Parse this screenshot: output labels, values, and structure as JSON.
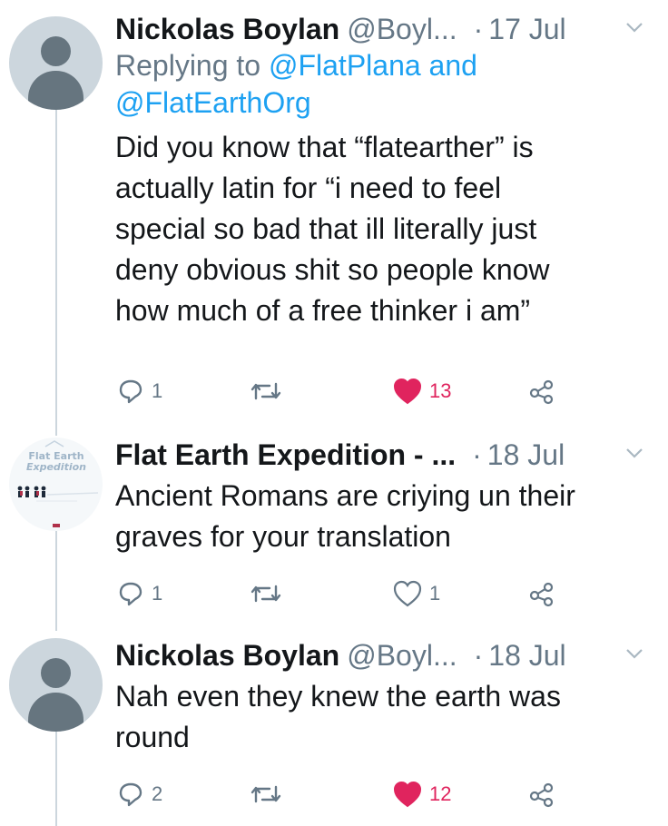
{
  "tweets": [
    {
      "name": "Nickolas Boylan",
      "handle": "@Boyl...",
      "dot": "·",
      "time": "17 Jul",
      "replying_prefix": "Replying to",
      "replying_user1": "@FlatPlana",
      "replying_and": "and",
      "replying_user2": "@FlatEarthOrg",
      "text_lines": [
        "Did you know that “flatearther” is",
        "actually latin for “i need to feel",
        "special so bad that ill literally just",
        "deny obvious shit so people know",
        "how much of a free thinker i am”"
      ],
      "reply_count": "1",
      "like_count": "13",
      "liked": true
    },
    {
      "name": "Flat Earth Expedition - ...",
      "dot": "·",
      "time": "18 Jul",
      "avatar_text_1": "Flat Earth",
      "avatar_text_2": "Expedition",
      "text_lines": [
        "Ancient Romans are criying un their",
        "graves for your translation"
      ],
      "reply_count": "1",
      "like_count": "1",
      "liked": false
    },
    {
      "name": "Nickolas Boylan",
      "handle": "@Boyl...",
      "dot": "·",
      "time": "18 Jul",
      "text_lines": [
        "Nah even they knew the earth was",
        "round"
      ],
      "reply_count": "2",
      "like_count": "12",
      "liked": true
    }
  ],
  "colors": {
    "liked": "#e0245e",
    "link": "#1da1f2",
    "muted": "#657786"
  },
  "icons": [
    "reply-icon",
    "retweet-icon",
    "like-icon",
    "share-icon",
    "chevron-down-icon"
  ]
}
